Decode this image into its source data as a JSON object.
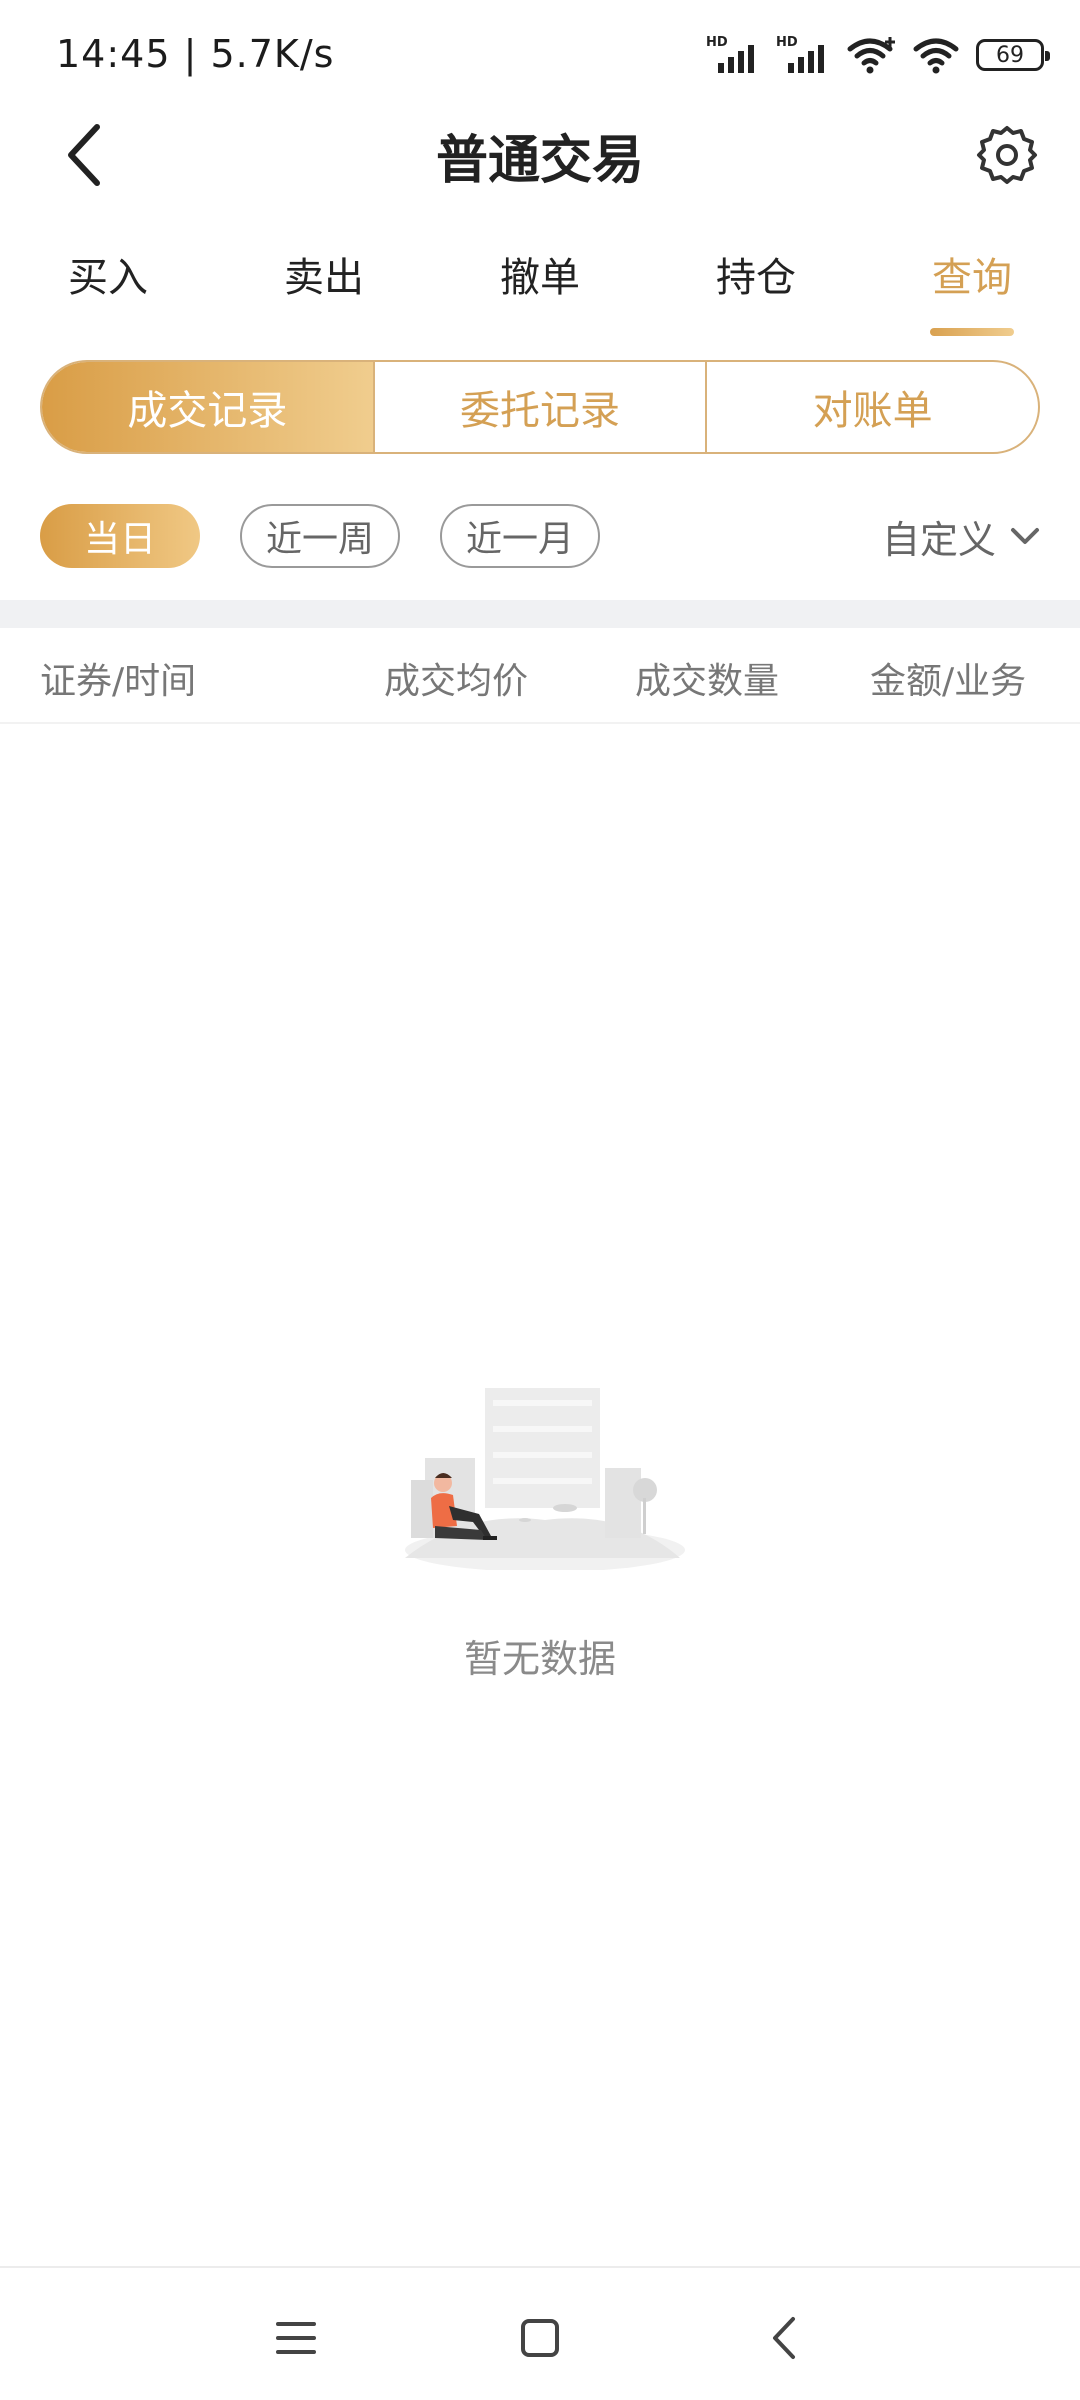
{
  "status_bar": {
    "time_speed": "14:45 | 5.7K/s",
    "signal1_label": "HD",
    "signal2_label": "HD",
    "battery_level": "69"
  },
  "header": {
    "title": "普通交易",
    "back_icon": "back-arrow-icon",
    "settings_icon": "gear-icon"
  },
  "main_tabs": [
    {
      "label": "买入"
    },
    {
      "label": "卖出"
    },
    {
      "label": "撤单"
    },
    {
      "label": "持仓"
    },
    {
      "label": "查询",
      "active": true
    }
  ],
  "segments": [
    {
      "label": "成交记录",
      "active": true
    },
    {
      "label": "委托记录"
    },
    {
      "label": "对账单"
    }
  ],
  "filters": {
    "chips": [
      {
        "label": "当日",
        "active": true
      },
      {
        "label": "近一周"
      },
      {
        "label": "近一月"
      }
    ],
    "custom_label": "自定义"
  },
  "table": {
    "columns": [
      "证券/时间",
      "成交均价",
      "成交数量",
      "金额/业务"
    ]
  },
  "empty_state": {
    "text": "暂无数据"
  },
  "colors": {
    "accent": "#d4a054",
    "gradient_start": "#d99d46",
    "gradient_end": "#f0cd8e"
  }
}
